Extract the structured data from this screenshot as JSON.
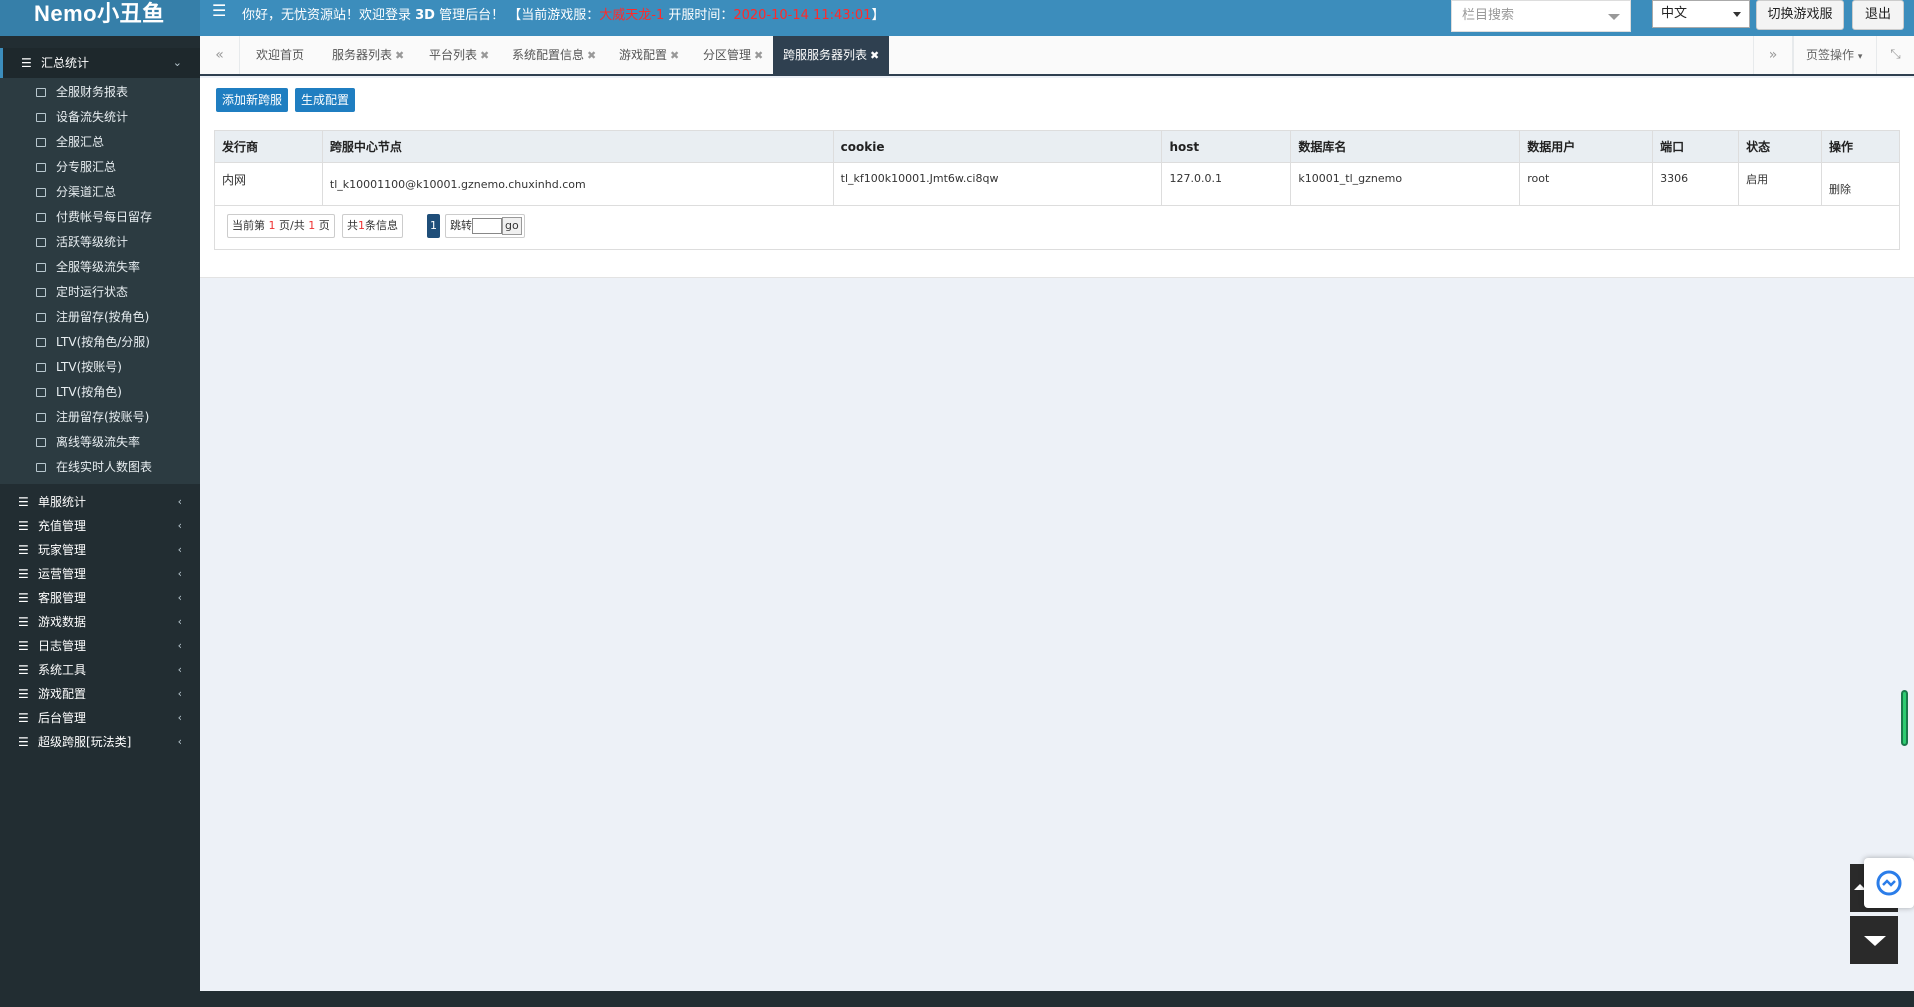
{
  "header": {
    "logo": "Nemo小丑鱼",
    "welcome_prefix": "你好，无忧资源站！欢迎登录 ",
    "welcome_3d": "3D",
    "welcome_suffix": " 管理后台！ 【当前游戏服：",
    "current_server": "大威天龙-1",
    "open_label": " 开服时间：",
    "open_time": "2020-10-14 11:43:01",
    "close_bracket": "】",
    "column_search_placeholder": "栏目搜索",
    "language": "中文",
    "switch_server_label": "切换游戏服",
    "logout_label": "退出"
  },
  "sidebar": {
    "active_group": "汇总统计",
    "sub_items": [
      "全服财务报表",
      "设备流失统计",
      "全服汇总",
      "分专服汇总",
      "分渠道汇总",
      "付费帐号每日留存",
      "活跃等级统计",
      "全服等级流失率",
      "定时运行状态",
      "注册留存(按角色)",
      "LTV(按角色/分服)",
      "LTV(按账号)",
      "LTV(按角色)",
      "注册留存(按账号)",
      "离线等级流失率",
      "在线实时人数图表"
    ],
    "groups": [
      "单服统计",
      "充值管理",
      "玩家管理",
      "运营管理",
      "客服管理",
      "游戏数据",
      "日志管理",
      "系统工具",
      "游戏配置",
      "后台管理",
      "超级跨服[玩法类]"
    ]
  },
  "tabs": {
    "items": [
      {
        "label": "欢迎首页",
        "closable": false
      },
      {
        "label": "服务器列表",
        "closable": true
      },
      {
        "label": "平台列表",
        "closable": true
      },
      {
        "label": "系统配置信息",
        "closable": true
      },
      {
        "label": "游戏配置",
        "closable": true
      },
      {
        "label": "分区管理",
        "closable": true
      },
      {
        "label": "跨服服务器列表",
        "closable": true,
        "active": true
      }
    ],
    "close_glyph": "✖",
    "ops_label": "页签操作"
  },
  "toolbar": {
    "add_label": "添加新跨服",
    "generate_label": "生成配置"
  },
  "table": {
    "headers": [
      "发行商",
      "跨服中心节点",
      "cookie",
      "host",
      "数据库名",
      "数据用户",
      "端口",
      "状态",
      "操作"
    ],
    "rows": [
      [
        "内网",
        "tl_k10001100@k10001.gznemo.chuxinhd.com",
        "tl_kf100k10001.Jmt6w.ci8qw",
        "127.0.0.1",
        "k10001_tl_gznemo",
        "root",
        "3306",
        "启用",
        "删除"
      ]
    ]
  },
  "pager": {
    "page_prefix": "当前第 ",
    "page_cur": "1",
    "page_mid": " 页/共 ",
    "page_total": "1",
    "page_suffix": " 页",
    "count_prefix": "共",
    "count": "1",
    "count_suffix": "条信息",
    "current_page_button": "1",
    "jump_label": "跳转",
    "go_label": "go"
  },
  "colors": {
    "topbar": "#3c8dbc",
    "sidebar": "#222d32",
    "primary_button": "#1f7ec1",
    "active_tab": "#2f4050",
    "highlight_red": "#ff2a2a"
  }
}
